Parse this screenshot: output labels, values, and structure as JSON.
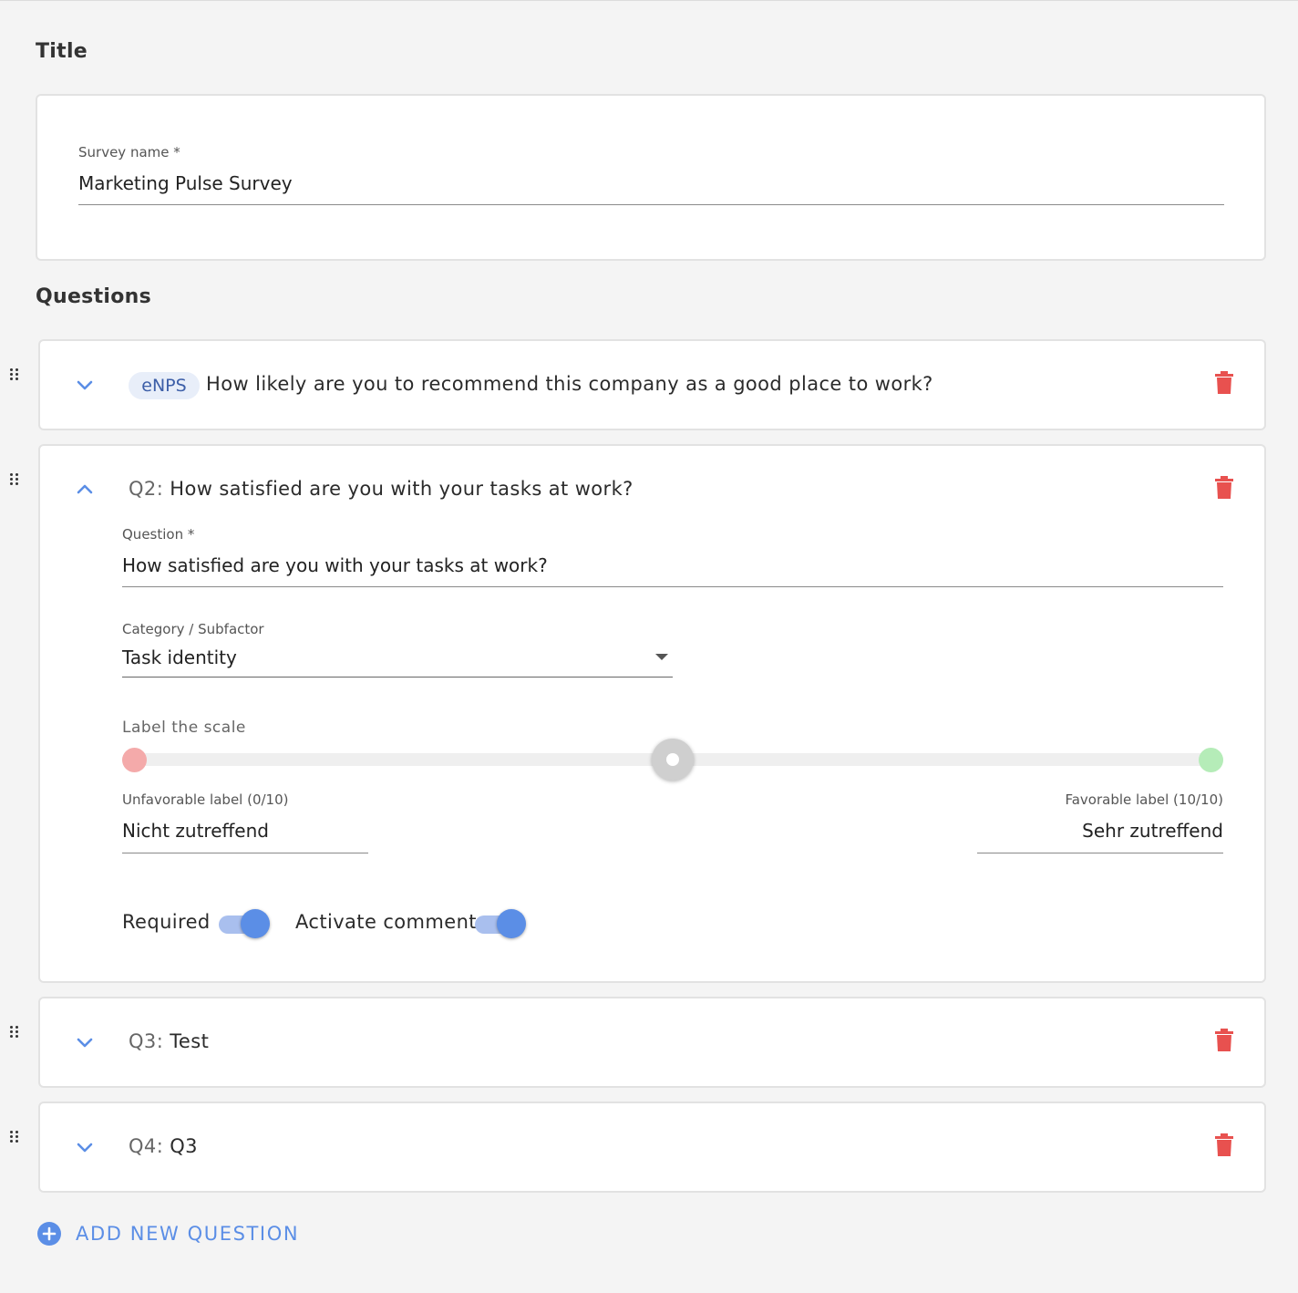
{
  "title_section": {
    "heading": "Title",
    "survey_name_label": "Survey name *",
    "survey_name_value": "Marketing Pulse Survey"
  },
  "questions_section": {
    "heading": "Questions",
    "q1": {
      "badge": "eNPS",
      "text": "How likely are you to recommend this company as a good place to work?"
    },
    "q2": {
      "number": "Q2:",
      "title": "How satisfied are you with your tasks at work?",
      "question_label": "Question *",
      "question_value": "How satisfied are you with your tasks at work?",
      "category_label": "Category / Subfactor",
      "category_value": "Task identity",
      "scale_label": "Label the scale",
      "scale_value": 0.5,
      "unfavorable_label": "Unfavorable label (0/10)",
      "unfavorable_value": "Nicht zutreffend",
      "favorable_label": "Favorable label (10/10)",
      "favorable_value": "Sehr zutreffend",
      "required_label": "Required",
      "required_on": true,
      "comment_label": "Activate comment",
      "comment_on": true
    },
    "q3": {
      "number": "Q3:",
      "title": "Test"
    },
    "q4": {
      "number": "Q4:",
      "title": "Q3"
    }
  },
  "add_question_label": "ADD NEW QUESTION",
  "colors": {
    "accent": "#5b8ee6",
    "delete": "#e8514f",
    "scale_low": "#f4aaaa",
    "scale_high": "#b5ecb8",
    "background": "#f4f4f4"
  },
  "icons": {
    "drag": "drag-handle-icon",
    "expand": "chevron-down-icon",
    "collapse": "chevron-up-icon",
    "delete": "trash-icon",
    "add": "plus-circle-icon"
  }
}
